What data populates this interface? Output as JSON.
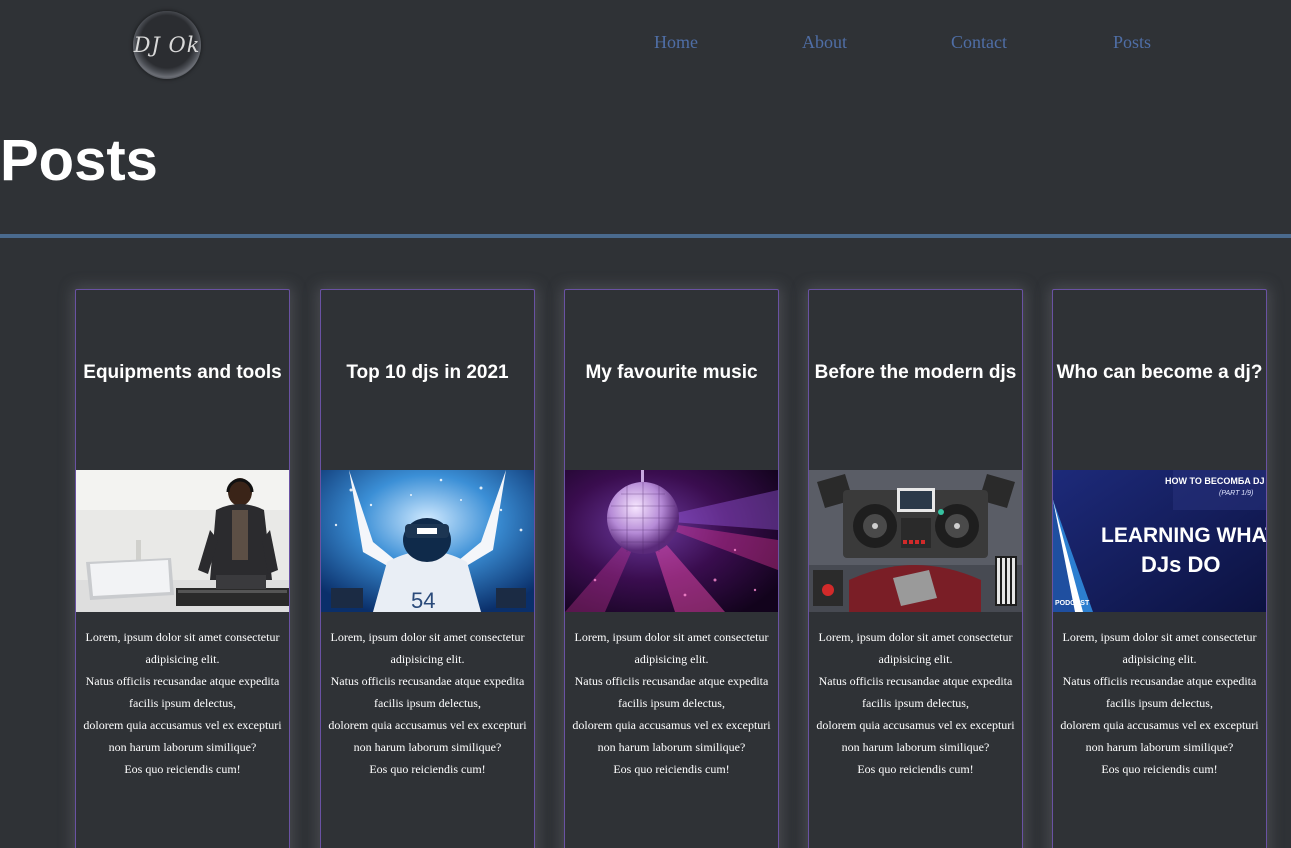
{
  "logo": {
    "text": "DJ Ok"
  },
  "nav": {
    "items": [
      "Home",
      "About",
      "Contact",
      "Posts"
    ],
    "link_color": "#4f6ea6"
  },
  "page": {
    "title": "Posts"
  },
  "colors": {
    "background": "#2f3236",
    "divider": "#4a6a8e",
    "card_border": "#6a52a3"
  },
  "posts": [
    {
      "title": "Equipments and tools",
      "image": "dj-at-laptop-image",
      "body": [
        "Lorem, ipsum dolor sit amet consectetur",
        "adipisicing elit.",
        "Natus officiis recusandae atque expedita",
        "facilis ipsum delectus,",
        "dolorem quia accusamus vel ex excepturi",
        "non harum laborum similique?",
        "Eos quo reiciendis cum!"
      ]
    },
    {
      "title": "Top 10 djs in 2021",
      "image": "dj-crowd-sparks-image",
      "body": [
        "Lorem, ipsum dolor sit amet consectetur",
        "adipisicing elit.",
        "Natus officiis recusandae atque expedita",
        "facilis ipsum delectus,",
        "dolorem quia accusamus vel ex excepturi",
        "non harum laborum similique?",
        "Eos quo reiciendis cum!"
      ]
    },
    {
      "title": "My favourite music",
      "image": "disco-ball-image",
      "body": [
        "Lorem, ipsum dolor sit amet consectetur",
        "adipisicing elit.",
        "Natus officiis recusandae atque expedita",
        "facilis ipsum delectus,",
        "dolorem quia accusamus vel ex excepturi",
        "non harum laborum similique?",
        "Eos quo reiciendis cum!"
      ]
    },
    {
      "title": "Before the modern djs",
      "image": "dj-deck-illustration-image",
      "body": [
        "Lorem, ipsum dolor sit amet consectetur",
        "adipisicing elit.",
        "Natus officiis recusandae atque expedita",
        "facilis ipsum delectus,",
        "dolorem quia accusamus vel ex excepturi",
        "non harum laborum similique?",
        "Eos quo reiciendis cum!"
      ]
    },
    {
      "title": "Who can become a dj?",
      "image": "podcast-banner-image",
      "image_text": {
        "top": "HOW TO BECOMБA DJ",
        "part": "(PART 1/9)",
        "line1": "LEARNING WHAT",
        "line2": "DJs DO",
        "badge": "PODCAST"
      },
      "body": [
        "Lorem, ipsum dolor sit amet consectetur",
        "adipisicing elit.",
        "Natus officiis recusandae atque expedita",
        "facilis ipsum delectus,",
        "dolorem quia accusamus vel ex excepturi",
        "non harum laborum similique?",
        "Eos quo reiciendis cum!"
      ]
    }
  ]
}
